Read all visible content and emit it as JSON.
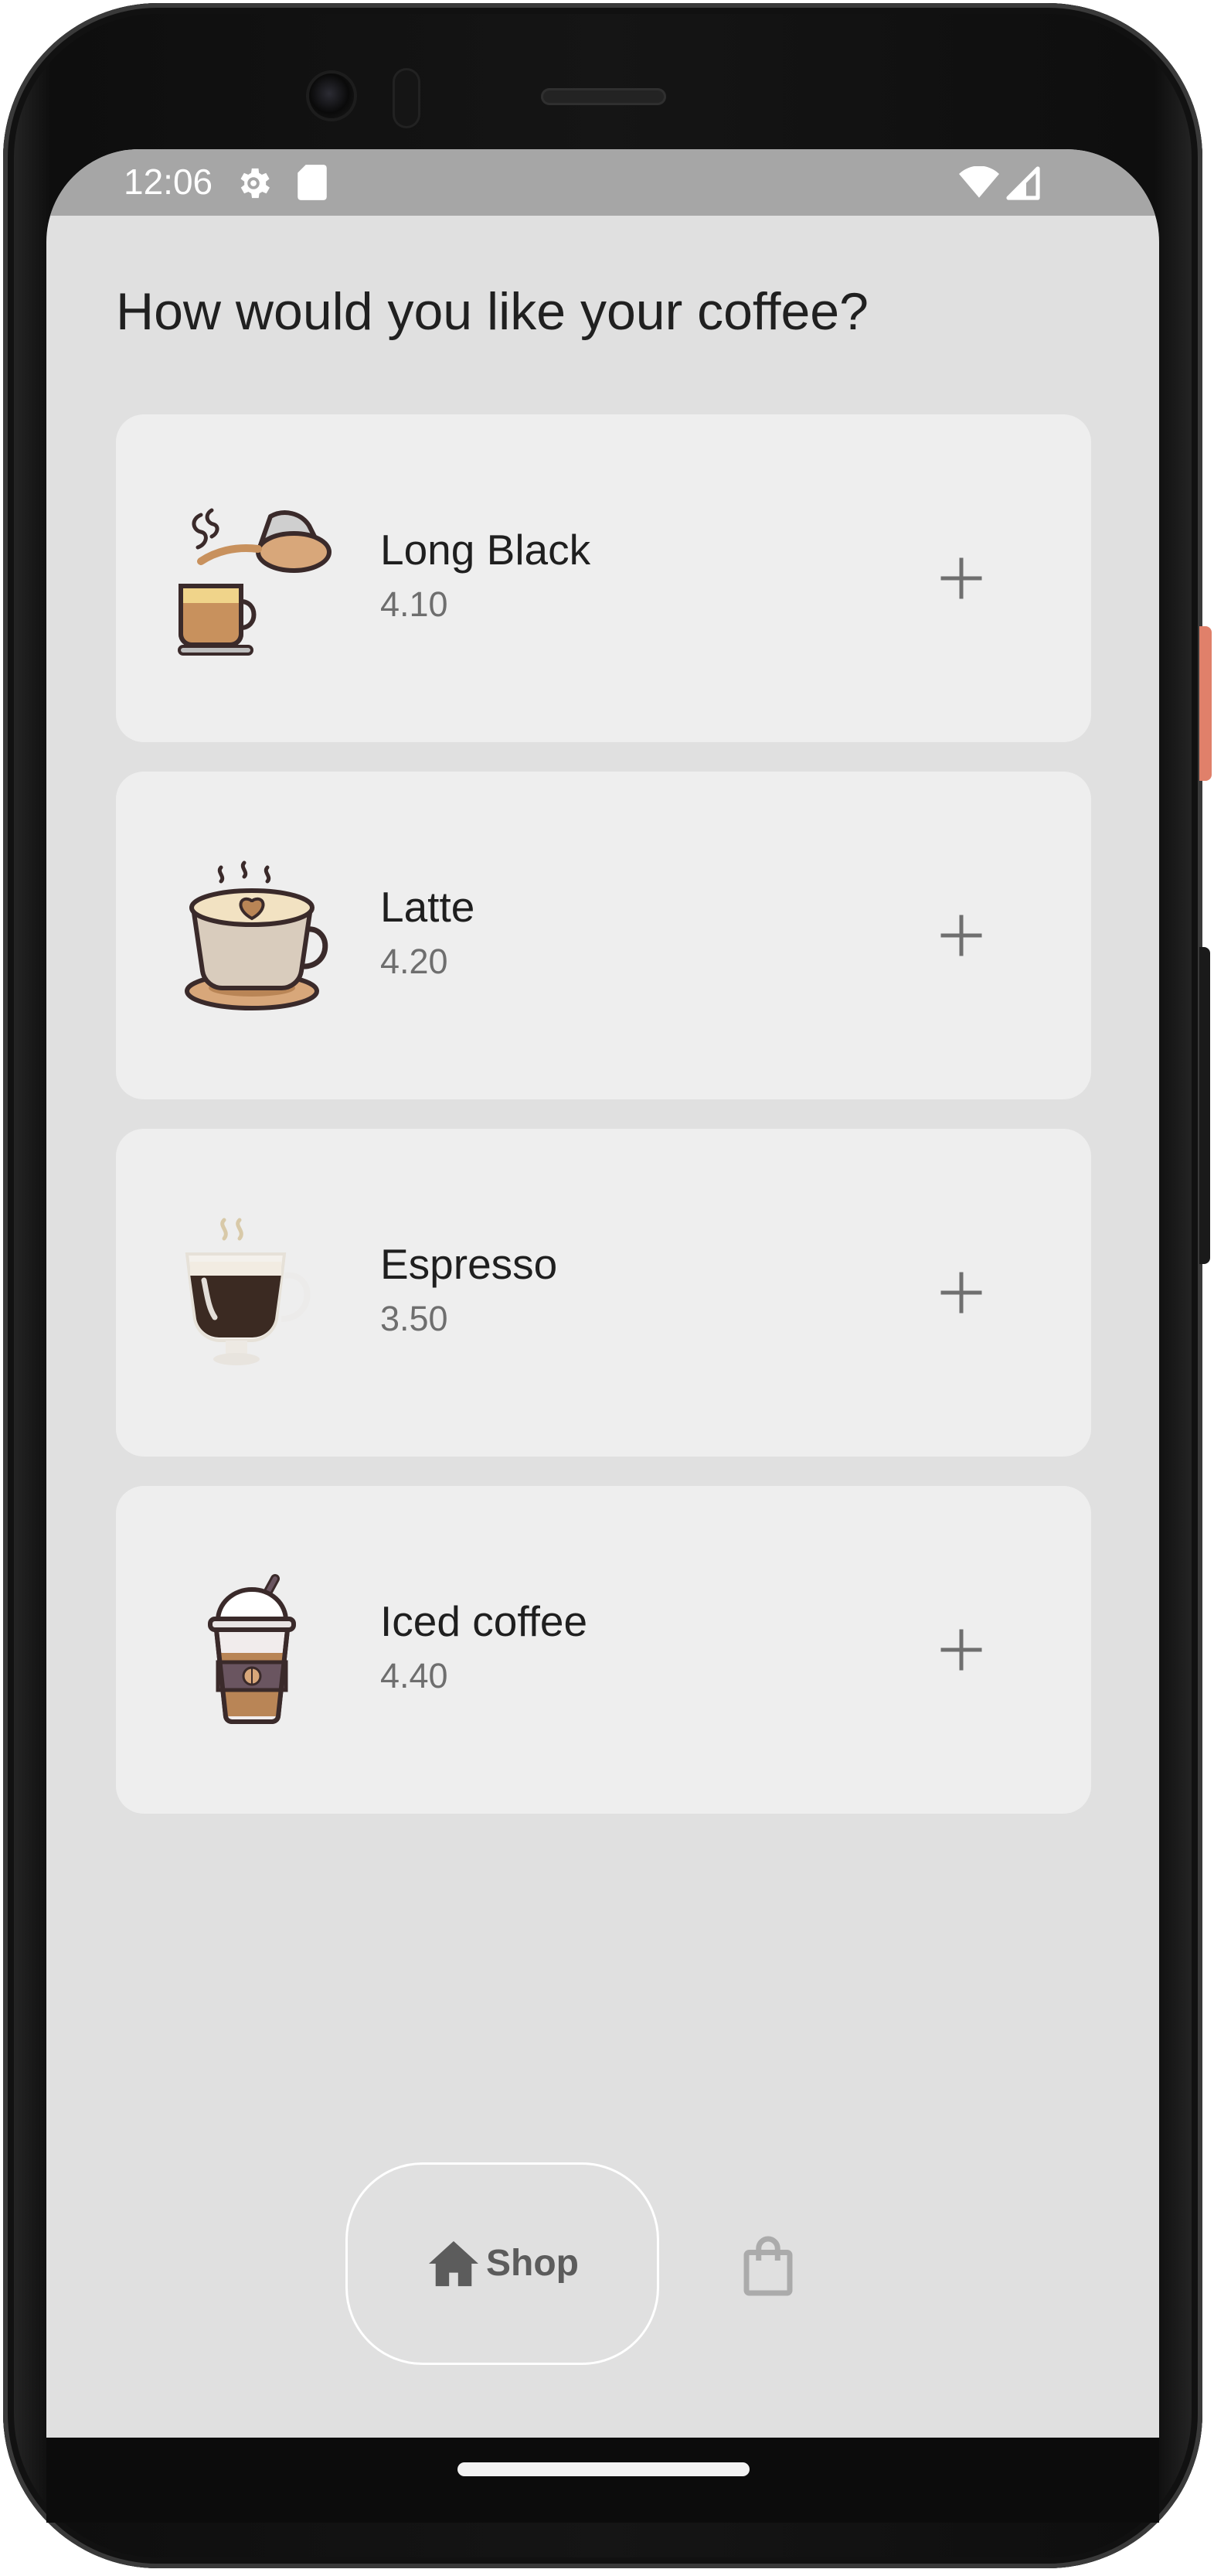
{
  "status_bar": {
    "time": "12:06",
    "icons": [
      "settings-gear-icon",
      "sd-card-icon",
      "wifi-icon",
      "cell-signal-icon"
    ]
  },
  "page": {
    "title": "How would you like your coffee?"
  },
  "menu": {
    "items": [
      {
        "name": "Long Black",
        "price": "4.10",
        "icon": "long-black-coffee-icon"
      },
      {
        "name": "Latte",
        "price": "4.20",
        "icon": "latte-cup-icon"
      },
      {
        "name": "Espresso",
        "price": "3.50",
        "icon": "espresso-glass-icon"
      },
      {
        "name": "Iced coffee",
        "price": "4.40",
        "icon": "iced-coffee-cup-icon"
      }
    ],
    "add_icon": "plus-icon"
  },
  "bottom_nav": {
    "shop_label": "Shop",
    "shop_icon": "home-icon",
    "cart_icon": "shopping-bag-icon",
    "selected": "Shop"
  },
  "colors": {
    "background": "#e0e0e0",
    "card": "#eeeeee",
    "status_bar": "#a6a6a6",
    "title_text": "#202020",
    "price_text": "#6e6e6e",
    "nav_icon": "#5c5c5c"
  }
}
